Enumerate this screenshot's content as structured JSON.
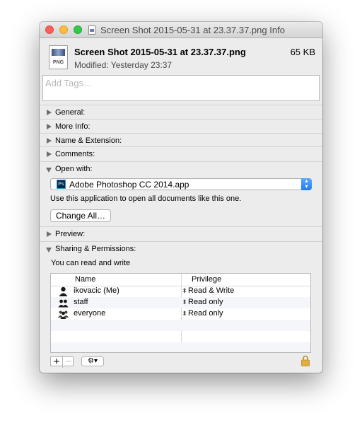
{
  "window": {
    "title": "Screen Shot 2015-05-31 at 23.37.37.png Info"
  },
  "file": {
    "icon_label": "PNG",
    "name": "Screen Shot 2015-05-31 at 23.37.37.png",
    "size": "65 KB",
    "modified": "Modified: Yesterday 23:37"
  },
  "tags": {
    "placeholder": "Add Tags…"
  },
  "sections": {
    "general": "General:",
    "more_info": "More Info:",
    "name_extension": "Name & Extension:",
    "comments": "Comments:",
    "open_with": "Open with:",
    "preview": "Preview:",
    "sharing": "Sharing & Permissions:"
  },
  "open_with": {
    "app_icon": "Ps",
    "app_name": "Adobe Photoshop CC 2014.app",
    "description": "Use this application to open all documents like this one.",
    "change_all_label": "Change All…"
  },
  "permissions": {
    "summary": "You can read and write",
    "columns": [
      "Name",
      "Privilege"
    ],
    "rows": [
      {
        "name": "ikovacic (Me)",
        "privilege": "Read & Write",
        "icon": "user-icon"
      },
      {
        "name": "staff",
        "privilege": "Read only",
        "icon": "group-icon"
      },
      {
        "name": "everyone",
        "privilege": "Read only",
        "icon": "everyone-icon"
      }
    ]
  },
  "toolbar": {
    "add_label": "+",
    "remove_label": "−",
    "action_label": "⚙▾"
  }
}
